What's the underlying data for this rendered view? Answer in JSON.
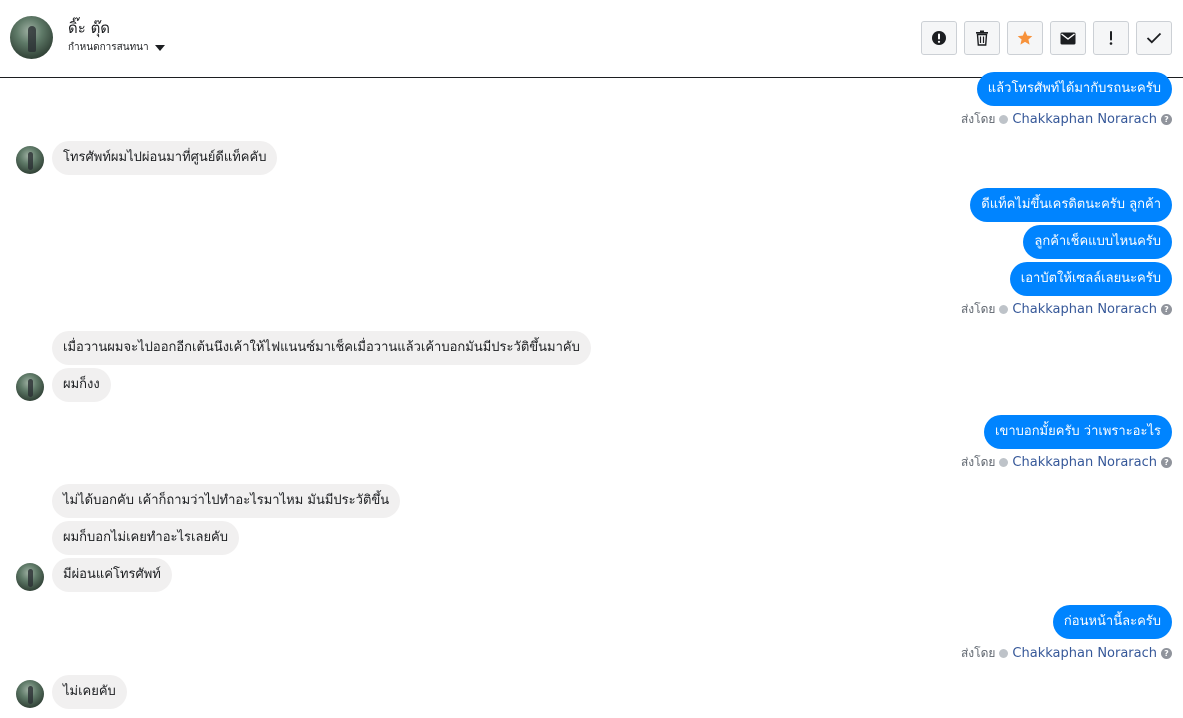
{
  "header": {
    "contact_name": "ดิ๊ะ ตุ๊ด",
    "manage_label": "กำหนดการสนทนา"
  },
  "toolbar": {
    "buttons": [
      {
        "icon": "exclamation-circle-icon"
      },
      {
        "icon": "trash-icon"
      },
      {
        "icon": "star-icon",
        "color": "#f7923b"
      },
      {
        "icon": "envelope-icon"
      },
      {
        "icon": "exclamation-icon"
      },
      {
        "icon": "check-icon"
      }
    ]
  },
  "sent_by": {
    "prefix": "ส่งโดย",
    "agent": "Chakkaphan Norarach",
    "help": "?"
  },
  "messages": {
    "m1": "แล้วโทรศัพท์ได้มากับรถนะครับ",
    "m2": "โทรศัพท์ผมไปผ่อนมาที่ศูนย์ดีแท็คคับ",
    "m3": "ดีแท็คไม่ขึ้นเครดิตนะครับ ลูกค้า",
    "m4": "ลูกค้าเช็คแบบไหนครับ",
    "m5": "เอาบัตให้เซลล์เลยนะครับ",
    "m6": "เมื่อวานผมจะไปออกอีกเต้นนึงเค้าให้ไฟแนนซ์มาเช็คเมื่อวานแล้วเค้าบอกมันมีประวัติขึ้นมาคับ",
    "m7": "ผมก็งง",
    "m8": "เขาบอกมั้ยครับ ว่าเพราะอะไร",
    "m9": "ไม่ได้บอกคับ เค้าก็ถามว่าไปทำอะไรมาไหม มันมีประวัติขึ้น",
    "m10": "ผมก็บอกไม่เคยทำอะไรเลยคับ",
    "m11": "มีผ่อนแค่โทรศัพท์",
    "m12": "ก่อนหน้านี้ละครับ",
    "m13": "ไม่เคยคับ"
  },
  "colors": {
    "outgoing_bubble": "#0084ff",
    "incoming_bubble": "#f1f0f0",
    "agent_link": "#365899"
  }
}
